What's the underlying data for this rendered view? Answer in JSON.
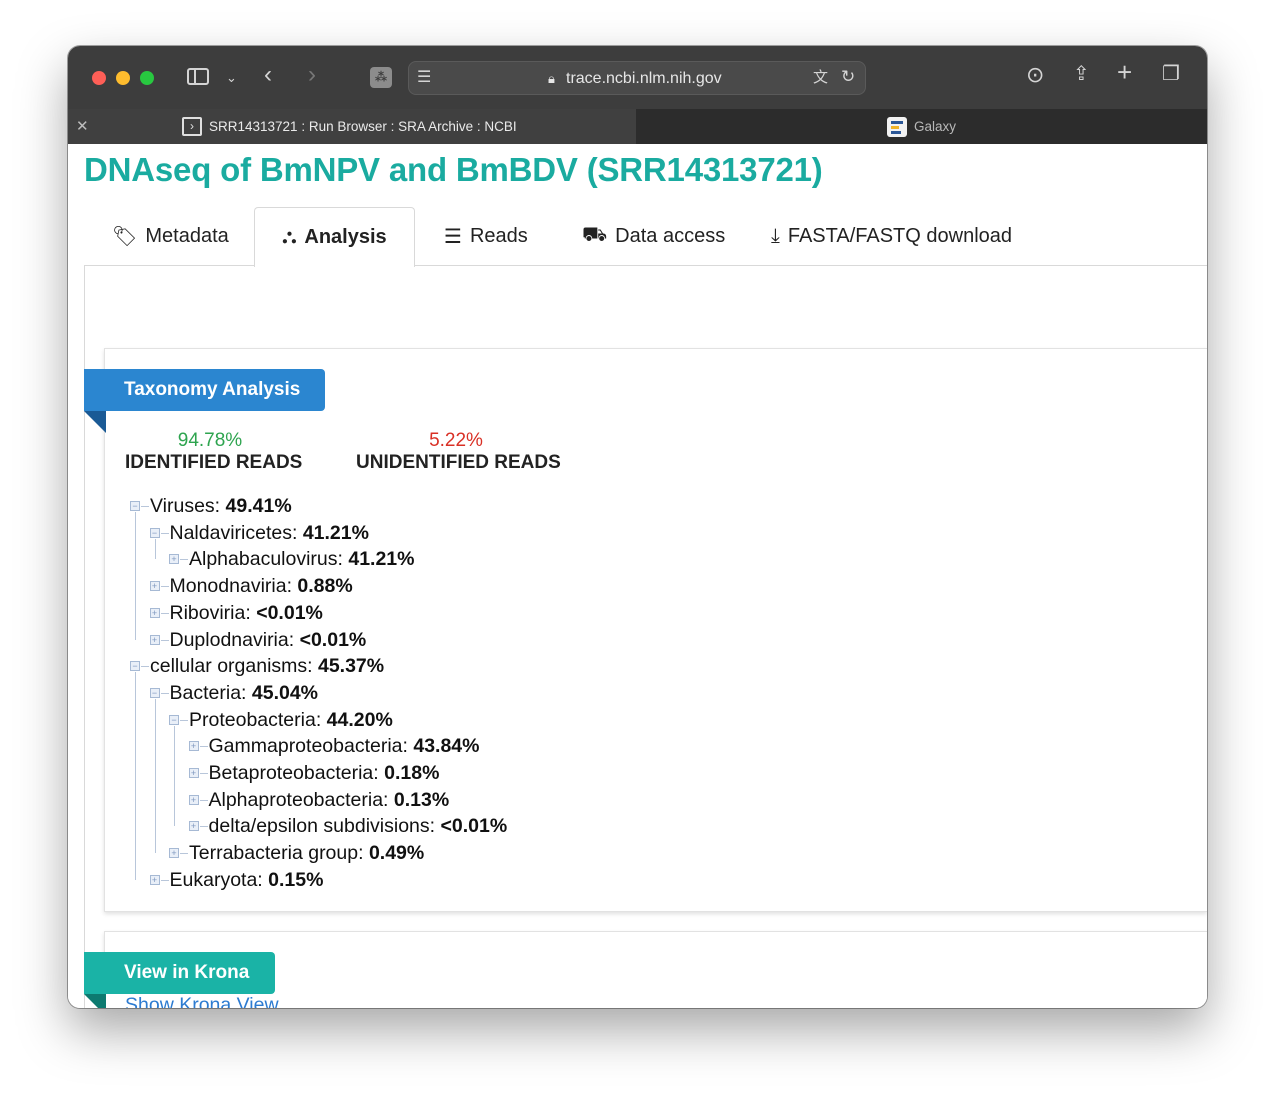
{
  "browser": {
    "url": "trace.ncbi.nlm.nih.gov",
    "tabs": [
      {
        "title": "SRR14313721 : Run Browser : SRA Archive : NCBI",
        "active": true
      },
      {
        "title": "Galaxy",
        "active": false
      }
    ],
    "icons": {
      "sidebar": "sidebar-icon",
      "back": "chevron-left-icon",
      "forward": "chevron-right-icon",
      "downloads": "download-icon",
      "share": "share-icon",
      "new_tab": "plus-icon",
      "tab_overview": "tabs-icon"
    }
  },
  "page": {
    "title": "DNAseq of BmNPV and BmBDV (SRR14313721)",
    "nav_tabs": [
      {
        "label": "Metadata",
        "icon": "tags-icon"
      },
      {
        "label": "Analysis",
        "icon": "sitemap-icon",
        "active": true
      },
      {
        "label": "Reads",
        "icon": "list-icon"
      },
      {
        "label": "Data access",
        "icon": "truck-icon"
      },
      {
        "label": "FASTA/FASTQ download",
        "icon": "download-icon"
      }
    ]
  },
  "taxonomy": {
    "heading": "Taxonomy Analysis",
    "identified": {
      "percent": "94.78%",
      "label": "IDENTIFIED READS"
    },
    "unidentified": {
      "percent": "5.22%",
      "label": "UNIDENTIFIED READS"
    },
    "tree": [
      {
        "name": "Viruses:",
        "value": "49.41%",
        "level": 0,
        "expanded": true
      },
      {
        "name": "Naldaviricetes:",
        "value": "41.21%",
        "level": 1,
        "expanded": true
      },
      {
        "name": "Alphabaculovirus:",
        "value": "41.21%",
        "level": 2,
        "expanded": false
      },
      {
        "name": "Monodnaviria:",
        "value": "0.88%",
        "level": 1,
        "expanded": false
      },
      {
        "name": "Riboviria:",
        "value": "<0.01%",
        "level": 1,
        "expanded": false
      },
      {
        "name": "Duplodnaviria:",
        "value": "<0.01%",
        "level": 1,
        "expanded": false
      },
      {
        "name": "cellular organisms:",
        "value": "45.37%",
        "level": 0,
        "expanded": true
      },
      {
        "name": "Bacteria:",
        "value": "45.04%",
        "level": 1,
        "expanded": true
      },
      {
        "name": "Proteobacteria:",
        "value": "44.20%",
        "level": 2,
        "expanded": true
      },
      {
        "name": "Gammaproteobacteria:",
        "value": "43.84%",
        "level": 3,
        "expanded": false
      },
      {
        "name": "Betaproteobacteria:",
        "value": "0.18%",
        "level": 3,
        "expanded": false
      },
      {
        "name": "Alphaproteobacteria:",
        "value": "0.13%",
        "level": 3,
        "expanded": false
      },
      {
        "name": "delta/epsilon subdivisions:",
        "value": "<0.01%",
        "level": 3,
        "expanded": false
      },
      {
        "name": "Terrabacteria group:",
        "value": "0.49%",
        "level": 2,
        "expanded": false
      },
      {
        "name": "Eukaryota:",
        "value": "0.15%",
        "level": 1,
        "expanded": false
      }
    ]
  },
  "krona": {
    "heading": "View in Krona",
    "link": "Show Krona View"
  },
  "colors": {
    "title": "#1aaba0",
    "taxonomy_ribbon": "#2b86d0",
    "krona_ribbon": "#1ab3a6",
    "identified": "#2ea44f",
    "unidentified": "#d93025",
    "link": "#2c7bd1"
  }
}
